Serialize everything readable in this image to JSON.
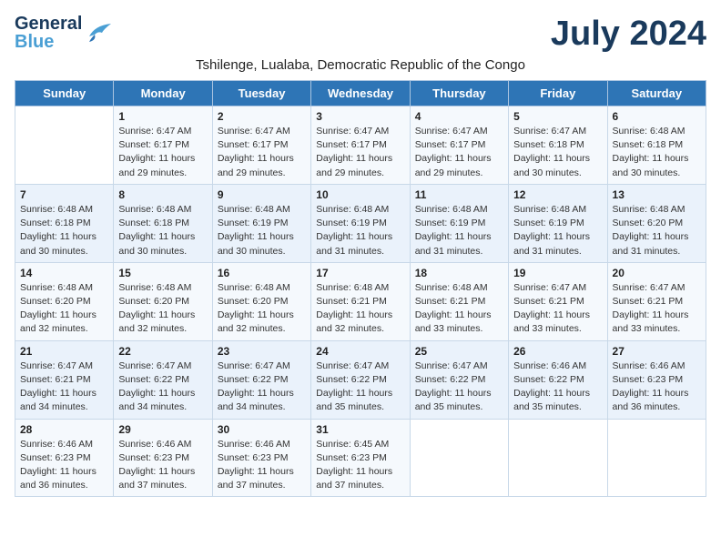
{
  "logo": {
    "general": "General",
    "blue": "Blue"
  },
  "title": "July 2024",
  "subtitle": "Tshilenge, Lualaba, Democratic Republic of the Congo",
  "days_of_week": [
    "Sunday",
    "Monday",
    "Tuesday",
    "Wednesday",
    "Thursday",
    "Friday",
    "Saturday"
  ],
  "weeks": [
    [
      {
        "day": "",
        "info": ""
      },
      {
        "day": "1",
        "info": "Sunrise: 6:47 AM\nSunset: 6:17 PM\nDaylight: 11 hours and 29 minutes."
      },
      {
        "day": "2",
        "info": "Sunrise: 6:47 AM\nSunset: 6:17 PM\nDaylight: 11 hours and 29 minutes."
      },
      {
        "day": "3",
        "info": "Sunrise: 6:47 AM\nSunset: 6:17 PM\nDaylight: 11 hours and 29 minutes."
      },
      {
        "day": "4",
        "info": "Sunrise: 6:47 AM\nSunset: 6:17 PM\nDaylight: 11 hours and 29 minutes."
      },
      {
        "day": "5",
        "info": "Sunrise: 6:47 AM\nSunset: 6:18 PM\nDaylight: 11 hours and 30 minutes."
      },
      {
        "day": "6",
        "info": "Sunrise: 6:48 AM\nSunset: 6:18 PM\nDaylight: 11 hours and 30 minutes."
      }
    ],
    [
      {
        "day": "7",
        "info": "Sunrise: 6:48 AM\nSunset: 6:18 PM\nDaylight: 11 hours and 30 minutes."
      },
      {
        "day": "8",
        "info": "Sunrise: 6:48 AM\nSunset: 6:18 PM\nDaylight: 11 hours and 30 minutes."
      },
      {
        "day": "9",
        "info": "Sunrise: 6:48 AM\nSunset: 6:19 PM\nDaylight: 11 hours and 30 minutes."
      },
      {
        "day": "10",
        "info": "Sunrise: 6:48 AM\nSunset: 6:19 PM\nDaylight: 11 hours and 31 minutes."
      },
      {
        "day": "11",
        "info": "Sunrise: 6:48 AM\nSunset: 6:19 PM\nDaylight: 11 hours and 31 minutes."
      },
      {
        "day": "12",
        "info": "Sunrise: 6:48 AM\nSunset: 6:19 PM\nDaylight: 11 hours and 31 minutes."
      },
      {
        "day": "13",
        "info": "Sunrise: 6:48 AM\nSunset: 6:20 PM\nDaylight: 11 hours and 31 minutes."
      }
    ],
    [
      {
        "day": "14",
        "info": "Sunrise: 6:48 AM\nSunset: 6:20 PM\nDaylight: 11 hours and 32 minutes."
      },
      {
        "day": "15",
        "info": "Sunrise: 6:48 AM\nSunset: 6:20 PM\nDaylight: 11 hours and 32 minutes."
      },
      {
        "day": "16",
        "info": "Sunrise: 6:48 AM\nSunset: 6:20 PM\nDaylight: 11 hours and 32 minutes."
      },
      {
        "day": "17",
        "info": "Sunrise: 6:48 AM\nSunset: 6:21 PM\nDaylight: 11 hours and 32 minutes."
      },
      {
        "day": "18",
        "info": "Sunrise: 6:48 AM\nSunset: 6:21 PM\nDaylight: 11 hours and 33 minutes."
      },
      {
        "day": "19",
        "info": "Sunrise: 6:47 AM\nSunset: 6:21 PM\nDaylight: 11 hours and 33 minutes."
      },
      {
        "day": "20",
        "info": "Sunrise: 6:47 AM\nSunset: 6:21 PM\nDaylight: 11 hours and 33 minutes."
      }
    ],
    [
      {
        "day": "21",
        "info": "Sunrise: 6:47 AM\nSunset: 6:21 PM\nDaylight: 11 hours and 34 minutes."
      },
      {
        "day": "22",
        "info": "Sunrise: 6:47 AM\nSunset: 6:22 PM\nDaylight: 11 hours and 34 minutes."
      },
      {
        "day": "23",
        "info": "Sunrise: 6:47 AM\nSunset: 6:22 PM\nDaylight: 11 hours and 34 minutes."
      },
      {
        "day": "24",
        "info": "Sunrise: 6:47 AM\nSunset: 6:22 PM\nDaylight: 11 hours and 35 minutes."
      },
      {
        "day": "25",
        "info": "Sunrise: 6:47 AM\nSunset: 6:22 PM\nDaylight: 11 hours and 35 minutes."
      },
      {
        "day": "26",
        "info": "Sunrise: 6:46 AM\nSunset: 6:22 PM\nDaylight: 11 hours and 35 minutes."
      },
      {
        "day": "27",
        "info": "Sunrise: 6:46 AM\nSunset: 6:23 PM\nDaylight: 11 hours and 36 minutes."
      }
    ],
    [
      {
        "day": "28",
        "info": "Sunrise: 6:46 AM\nSunset: 6:23 PM\nDaylight: 11 hours and 36 minutes."
      },
      {
        "day": "29",
        "info": "Sunrise: 6:46 AM\nSunset: 6:23 PM\nDaylight: 11 hours and 37 minutes."
      },
      {
        "day": "30",
        "info": "Sunrise: 6:46 AM\nSunset: 6:23 PM\nDaylight: 11 hours and 37 minutes."
      },
      {
        "day": "31",
        "info": "Sunrise: 6:45 AM\nSunset: 6:23 PM\nDaylight: 11 hours and 37 minutes."
      },
      {
        "day": "",
        "info": ""
      },
      {
        "day": "",
        "info": ""
      },
      {
        "day": "",
        "info": ""
      }
    ]
  ]
}
